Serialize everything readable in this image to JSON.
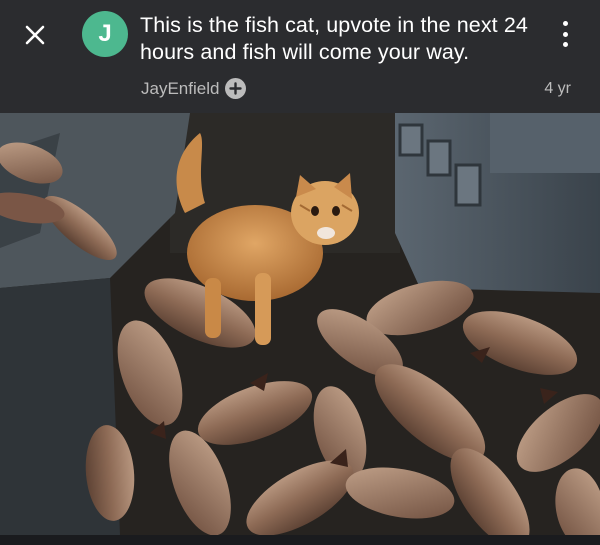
{
  "header": {
    "avatar_letter": "J",
    "title": "This is the fish cat, upvote in the next 24 hours and fish will come your way.",
    "author": "JayEnfield",
    "age": "4 yr"
  },
  "icons": {
    "close": "close-icon",
    "more": "more-vertical-icon",
    "follow": "plus-circle-icon"
  },
  "colors": {
    "header_bg": "#2b2c2f",
    "avatar_bg": "#4db88f",
    "secondary_text": "#bcbcbc"
  }
}
